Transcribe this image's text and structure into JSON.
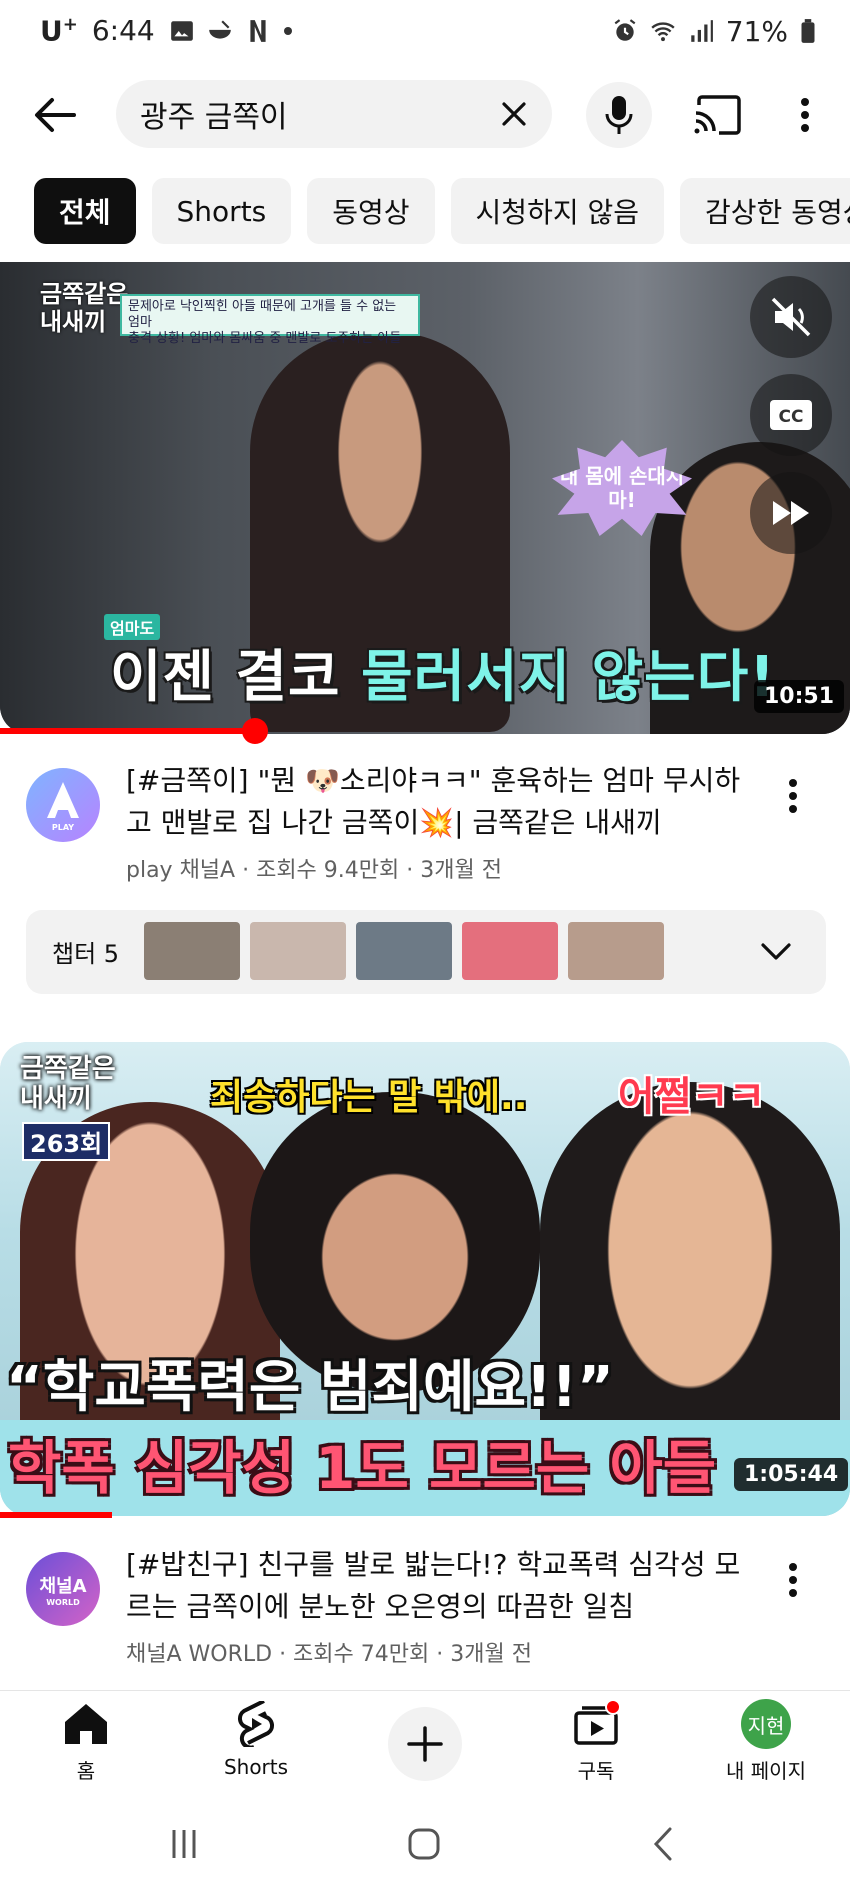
{
  "status_bar": {
    "carrier": "U",
    "carrier_sup": "+",
    "time": "6:44",
    "battery": "71%"
  },
  "search": {
    "query": "광주 금쪽이"
  },
  "chips": [
    "전체",
    "Shorts",
    "동영상",
    "시청하지 않음",
    "감상한 동영상"
  ],
  "videos": [
    {
      "thumb_logo_line1": "금쪽같은",
      "thumb_logo_line2": "내새끼",
      "thumb_banner_line1": "문제아로 낙인찍힌 아들 때문에 고개를 들 수 없는 엄마",
      "thumb_banner_line2": "충격 상황! 엄마와 몸싸움 중 맨발로 도주하는 아들",
      "thumb_bubble": "내 몸에 손대지 마!",
      "thumb_caption_tag": "엄마도",
      "thumb_caption_white": "이젠 결코 ",
      "thumb_caption_cyan": "물러서지 않는다!",
      "duration": "10:51",
      "title": "[#금쪽이] \"뭔 🐶소리야ㅋㅋ\" 훈육하는 엄마 무시하고 맨발로 집 나간 금쪽이💥| 금쪽같은 내새끼",
      "channel_avatar_text": "PLAY",
      "subtitle": "play 채널A · 조회수 9.4만회 · 3개월 전",
      "watched_fraction": 0.3
    },
    {
      "thumb_logo_line1": "금쪽같은",
      "thumb_logo_line2": "내새끼",
      "thumb_episode": "263회",
      "thumb_top_caption": "죄송하다는 말 밖에..",
      "thumb_top_caption_red": "어쩔ㅋㅋ",
      "thumb_quote": "“학교폭력은 범죄예요!!”",
      "thumb_red_caption": "학폭 심각성 1도 모르는 아들",
      "duration": "1:05:44",
      "title": "[#밥친구] 친구를 발로 밟는다!? 학교폭력 심각성 모르는 금쪽이에 분노한 오은영의 따끔한 일침",
      "channel_avatar_text": "채널A",
      "channel_avatar_sub": "WORLD",
      "subtitle": "채널A WORLD · 조회수 74만회 · 3개월 전",
      "watched_fraction": 0.13
    }
  ],
  "chapters": {
    "label": "챕터 5",
    "thumb_colors": [
      "#8b7f74",
      "#c9b7ad",
      "#6d7a86",
      "#e46f7d",
      "#b79c8c"
    ]
  },
  "bottom_nav": {
    "home": "홈",
    "shorts": "Shorts",
    "subscriptions": "구독",
    "me": "내 페이지",
    "me_avatar": "지현"
  },
  "colors": {
    "accent": "#ff0000",
    "chip_active_bg": "#0f0f0f",
    "chip_bg": "#f2f2f2",
    "secondary_text": "#606060"
  }
}
